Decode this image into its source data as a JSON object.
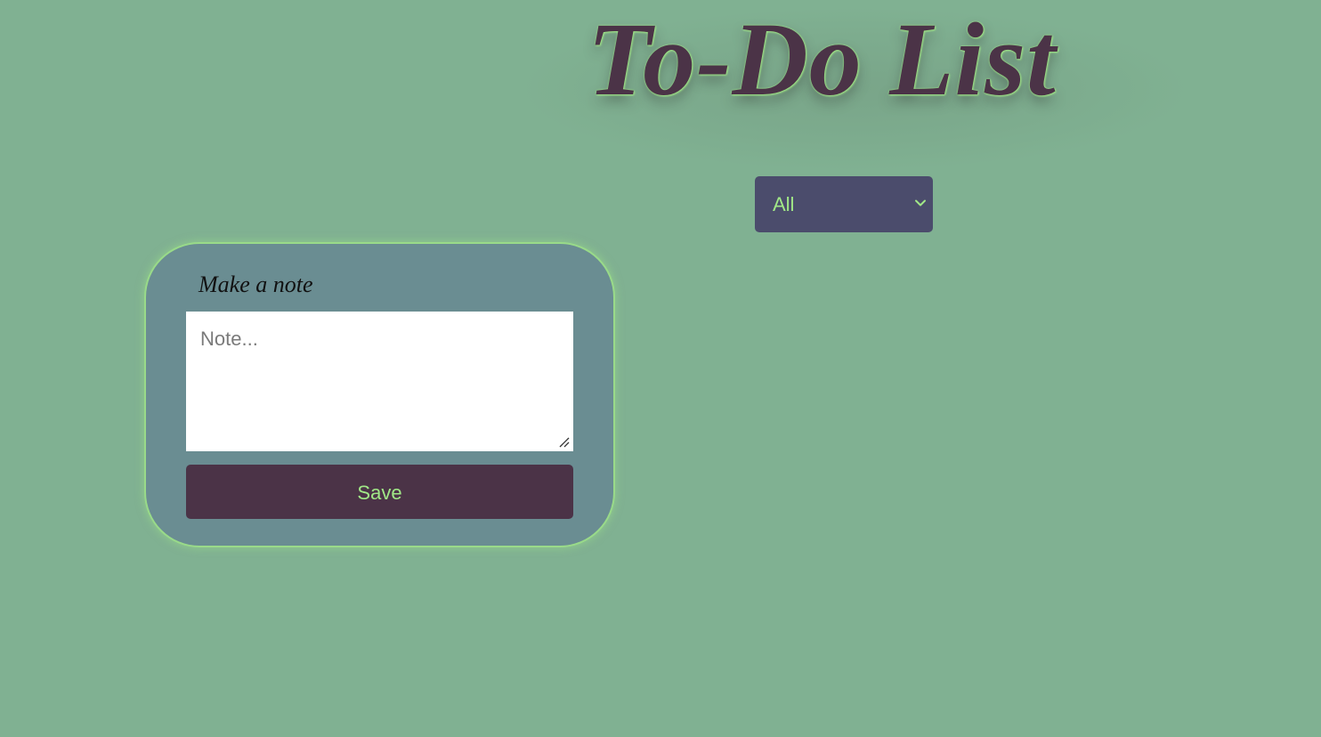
{
  "header": {
    "title": "To-Do List"
  },
  "filter": {
    "selected": "All",
    "icon": "chevron-down-icon"
  },
  "note_form": {
    "heading": "Make a note",
    "textarea_placeholder": "Note...",
    "textarea_value": "",
    "save_label": "Save"
  },
  "colors": {
    "background": "#80b192",
    "title": "#4b3347",
    "accent_green": "#a1e887",
    "select_background": "#4b4c6c",
    "card_background": "#6a8d92",
    "button_background": "#4b3347"
  }
}
